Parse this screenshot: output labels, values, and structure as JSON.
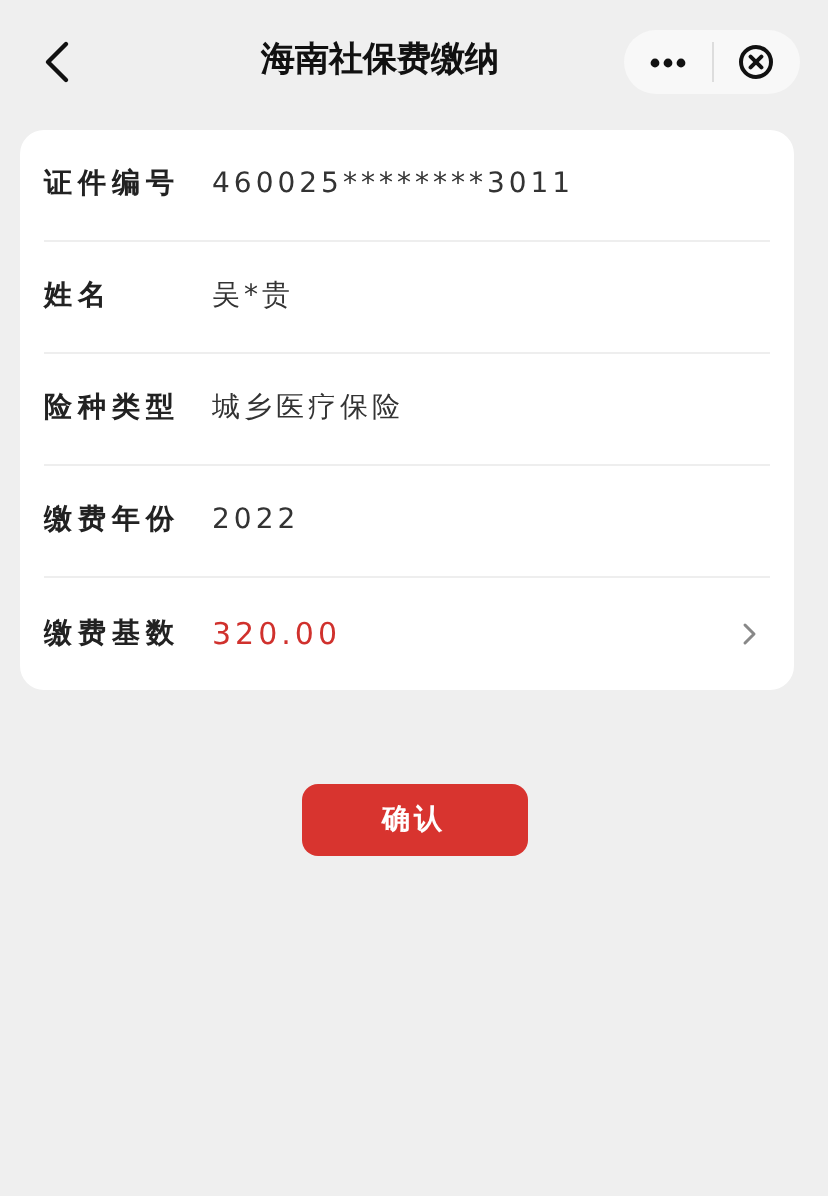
{
  "header": {
    "title": "海南社保费缴纳"
  },
  "fields": [
    {
      "label": "证件编号",
      "value": "460025********3011",
      "kind": "text"
    },
    {
      "label": "姓名",
      "value": "吴*贵",
      "kind": "text"
    },
    {
      "label": "险种类型",
      "value": "城乡医疗保险",
      "kind": "text"
    },
    {
      "label": "缴费年份",
      "value": "2022",
      "kind": "text"
    },
    {
      "label": "缴费基数",
      "value": "320.00",
      "kind": "select"
    }
  ],
  "confirm_button": "确认"
}
